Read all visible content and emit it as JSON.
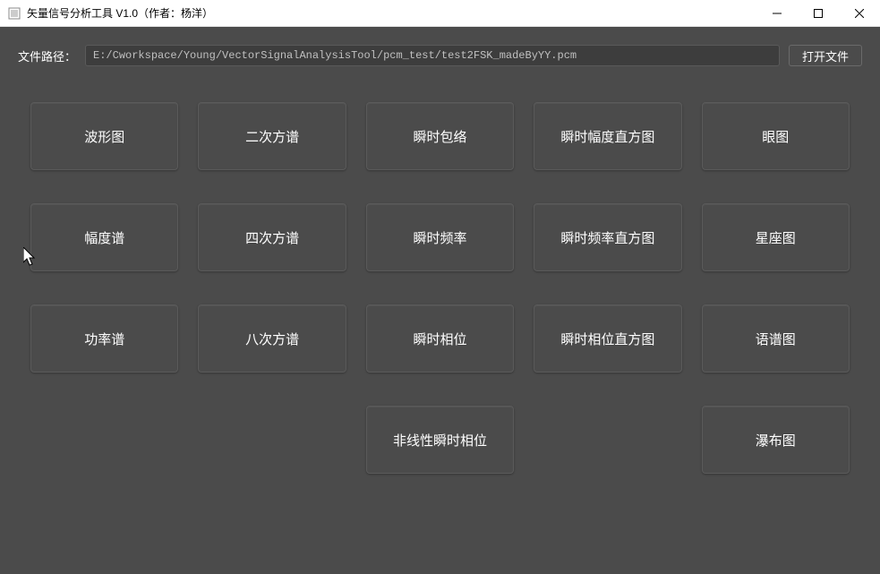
{
  "window": {
    "title": "矢量信号分析工具 V1.0（作者：杨洋）"
  },
  "toolbar": {
    "file_label": "文件路径：",
    "file_path": "E:/Cworkspace/Young/VectorSignalAnalysisTool/pcm_test/test2FSK_madeByYY.pcm",
    "open_file_label": "打开文件"
  },
  "buttons": {
    "row1": {
      "b0": "波形图",
      "b1": "二次方谱",
      "b2": "瞬时包络",
      "b3": "瞬时幅度直方图",
      "b4": "眼图"
    },
    "row2": {
      "b0": "幅度谱",
      "b1": "四次方谱",
      "b2": "瞬时频率",
      "b3": "瞬时频率直方图",
      "b4": "星座图"
    },
    "row3": {
      "b0": "功率谱",
      "b1": "八次方谱",
      "b2": "瞬时相位",
      "b3": "瞬时相位直方图",
      "b4": "语谱图"
    },
    "row4": {
      "b2": "非线性瞬时相位",
      "b4": "瀑布图"
    }
  }
}
